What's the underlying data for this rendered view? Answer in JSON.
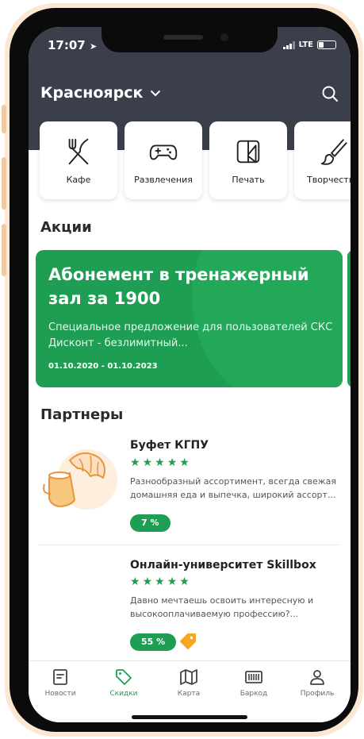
{
  "status_bar": {
    "time": "17:07",
    "network": "LTE"
  },
  "header": {
    "city": "Красноярск",
    "icons": {
      "city_dropdown": "chevron-down-icon",
      "search": "search-icon"
    }
  },
  "categories": [
    {
      "label": "Кафе",
      "icon": "fork-knife-icon"
    },
    {
      "label": "Развлечения",
      "icon": "gamepad-icon"
    },
    {
      "label": "Печать",
      "icon": "print-icon"
    },
    {
      "label": "Творчество",
      "icon": "brush-icon"
    }
  ],
  "promos": {
    "title": "Акции",
    "items": [
      {
        "title": "Абонемент в тренажерный зал за 1900",
        "description": "Специальное предложение для пользователей СКС Дисконт - безлимитный...",
        "dates": "01.10.2020 - 01.10.2023"
      }
    ]
  },
  "partners": {
    "title": "Партнеры",
    "items": [
      {
        "name": "Буфет КГПУ",
        "rating": 5,
        "description": "Разнообразный ассортимент, всегда свежая домашняя еда и выпечка, широкий ассорт...",
        "discount": "7 %",
        "logo": "coffee-croissant-logo"
      },
      {
        "name": "Онлайн-университет Skillbox",
        "rating": 5,
        "description": "Давно мечтаешь освоить интересную и высокооплачиваемую профессию?...",
        "discount": "55 %",
        "tag_icon": "price-tag-icon"
      }
    ]
  },
  "tabbar": {
    "active": "Скидки",
    "items": [
      {
        "label": "Новости",
        "icon": "news-icon"
      },
      {
        "label": "Скидки",
        "icon": "discount-tag-icon"
      },
      {
        "label": "Карта",
        "icon": "map-icon"
      },
      {
        "label": "Баркод",
        "icon": "barcode-icon"
      },
      {
        "label": "Профиль",
        "icon": "profile-icon"
      }
    ]
  },
  "colors": {
    "header_bg": "#3b3f4b",
    "accent_green": "#1e9e52",
    "tag_orange": "#f5a623",
    "bezel": "#fce7d2"
  }
}
